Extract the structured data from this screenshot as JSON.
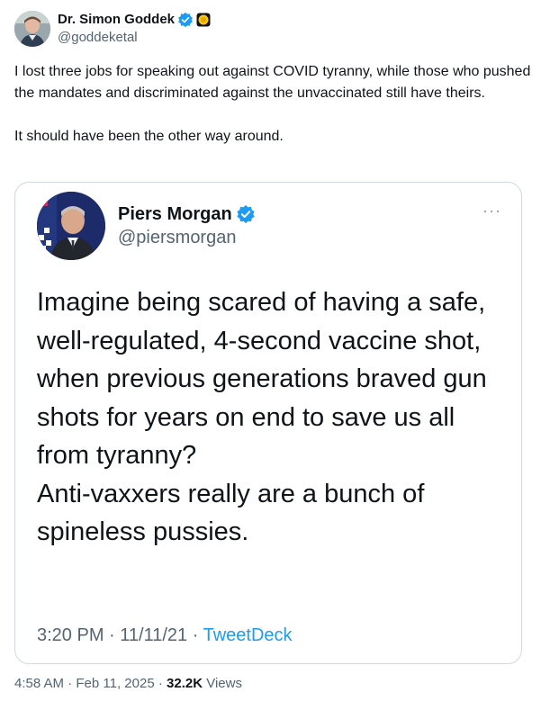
{
  "author": {
    "display_name": "Dr. Simon Goddek",
    "handle": "@goddeketal"
  },
  "tweet": {
    "paragraphs": [
      "I lost three jobs for speaking out against COVID tyranny, while those who pushed the mandates and discriminated against the unvaccinated still have theirs.",
      "It should have been the other way around."
    ],
    "time": "4:58 AM",
    "date": "Feb 11, 2025",
    "separator": "·",
    "views_count": "32.2K",
    "views_label": "Views"
  },
  "quoted": {
    "display_name": "Piers Morgan",
    "handle": "@piersmorgan",
    "more": "···",
    "text_lines": [
      "Imagine being scared of having a safe, well-regulated, 4-second vaccine shot, when previous generations braved gun shots for years on end to save us all from tyranny?",
      "Anti-vaxxers really are a bunch of spineless pussies."
    ],
    "time": "3:20 PM",
    "date": "11/11/21",
    "source": "TweetDeck"
  },
  "colors": {
    "verified_blue": "#1d9bf0",
    "affiliate_gold": "#f5c518",
    "secondary_text": "#536471",
    "border": "#cfd9de"
  }
}
